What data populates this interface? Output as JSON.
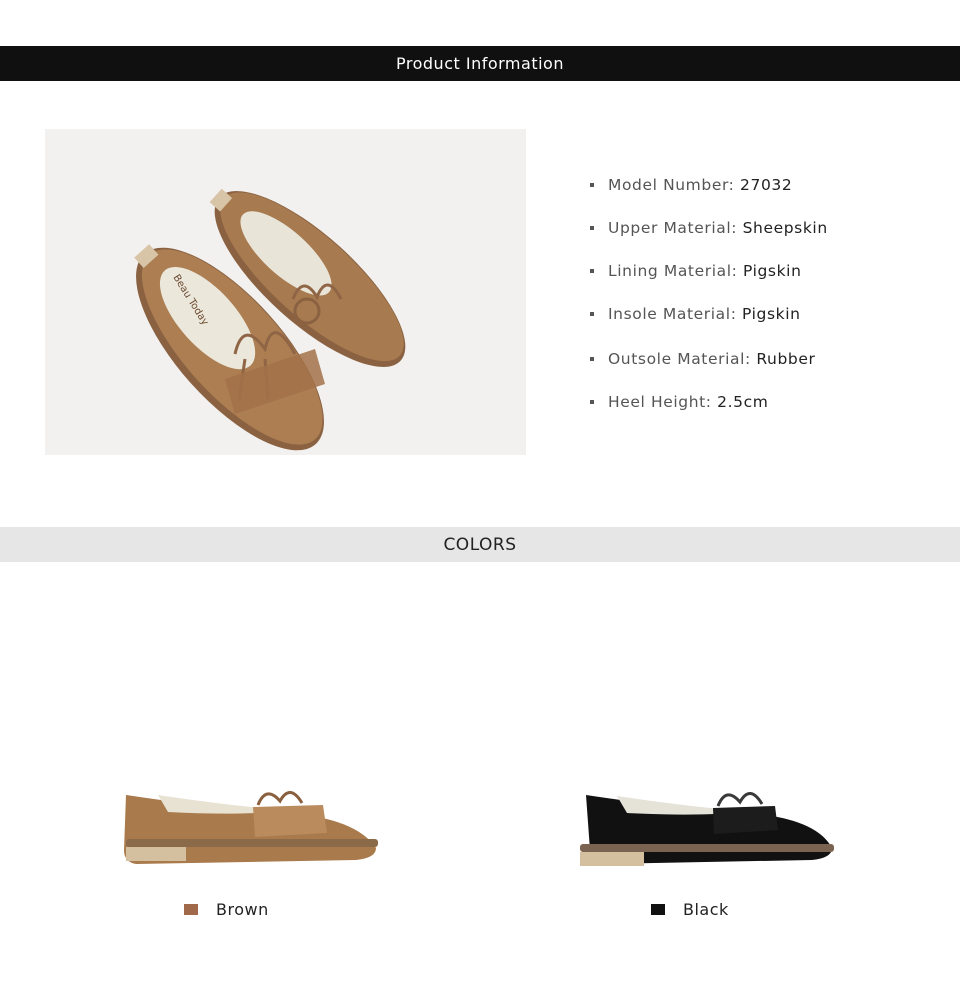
{
  "header": {
    "title": "Product Information"
  },
  "product_image": {
    "brand_print": "Beau Today",
    "color": "#a87a4f"
  },
  "specs": [
    {
      "label": "Model Number:",
      "value": "27032"
    },
    {
      "label": "Upper Material:",
      "value": "Sheepskin"
    },
    {
      "label": "Lining Material:",
      "value": "Pigskin"
    },
    {
      "label": "Insole Material:",
      "value": "Pigskin"
    },
    {
      "label": "Outsole Material:",
      "value": "Rubber"
    },
    {
      "label": "Heel Height:",
      "value": "2.5cm"
    }
  ],
  "colors_section": {
    "title": "COLORS",
    "variants": [
      {
        "name": "Brown",
        "swatch": "#a0694a",
        "shoe_color": "#a87a4f"
      },
      {
        "name": "Black",
        "swatch": "#111111",
        "shoe_color": "#111111"
      }
    ]
  }
}
